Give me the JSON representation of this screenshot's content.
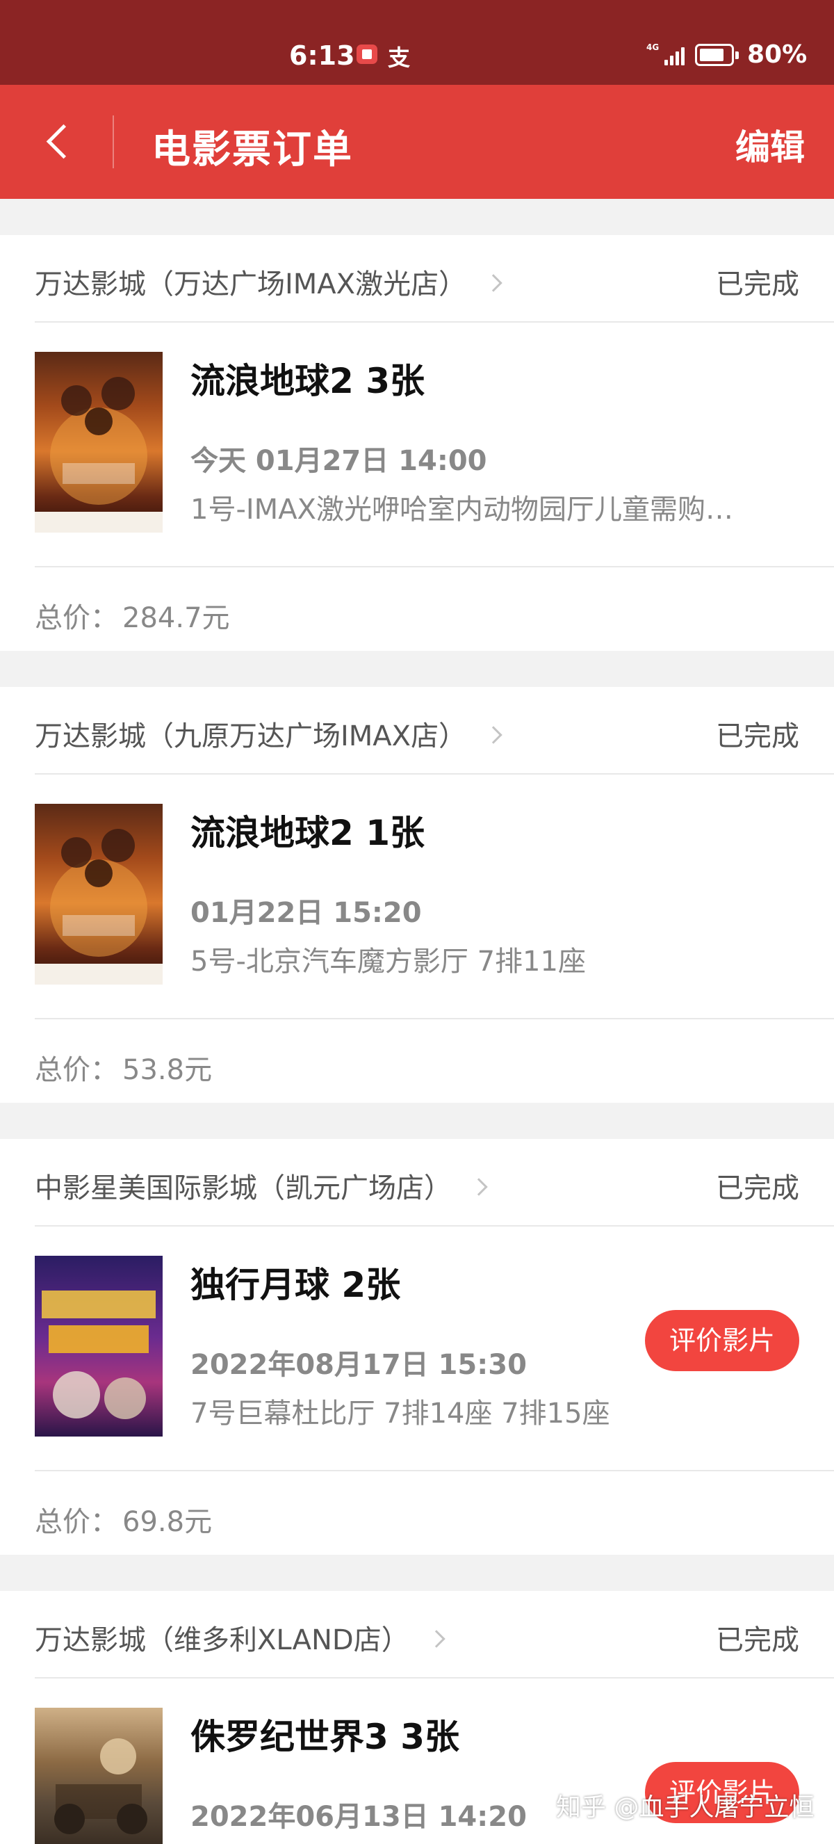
{
  "status_bar": {
    "time": "6:13",
    "alipay_glyph": "支",
    "network": "4G",
    "battery_percent": "80%",
    "battery_level": 0.8
  },
  "nav": {
    "title": "电影票订单",
    "edit_label": "编辑"
  },
  "orders": [
    {
      "cinema": "万达影城（万达广场IMAX激光店）",
      "status": "已完成",
      "poster": "wandering-earth-2-poster",
      "title": "流浪地球2 3张",
      "time": "今天 01月27日 14:00",
      "hall": "1号-IMAX激光咿哈室内动物园厅儿童需购…",
      "total_label": "总价：",
      "total": "284.7元"
    },
    {
      "cinema": "万达影城（九原万达广场IMAX店）",
      "status": "已完成",
      "poster": "wandering-earth-2-poster",
      "title": "流浪地球2 1张",
      "time": "01月22日 15:20",
      "hall": "5号-北京汽车魔方影厅 7排11座",
      "total_label": "总价：",
      "total": "53.8元"
    },
    {
      "cinema": "中影星美国际影城（凯元广场店）",
      "status": "已完成",
      "poster": "moon-man-poster",
      "title": "独行月球 2张",
      "time": "2022年08月17日 15:30",
      "hall": "7号巨幕杜比厅 7排14座 7排15座",
      "review_label": "评价影片",
      "total_label": "总价：",
      "total": "69.8元"
    },
    {
      "cinema": "万达影城（维多利XLAND店）",
      "status": "已完成",
      "poster": "jurassic-world-3-poster",
      "title": "侏罗纪世界3 3张",
      "time": "2022年06月13日 14:20",
      "review_label": "评价影片"
    }
  ],
  "watermark": "知乎 @血手人屠宁立恒",
  "colors": {
    "status_bar": "#8b2424",
    "nav_bar": "#e03f3a",
    "review_button": "#f2453f",
    "page_bg": "#f2f2f2"
  }
}
